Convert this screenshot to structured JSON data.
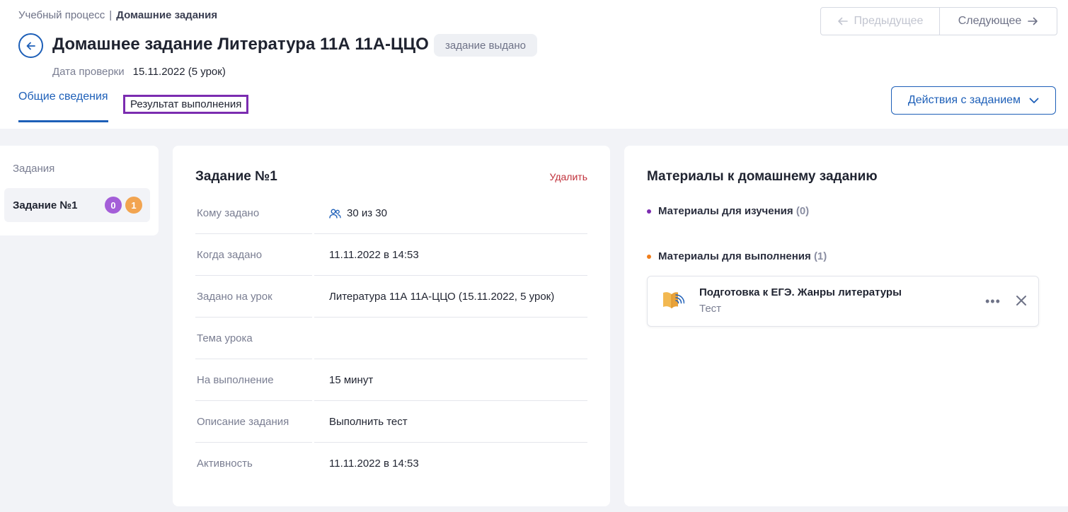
{
  "breadcrumb": {
    "parent": "Учебный процесс",
    "separator": "|",
    "current": "Домашние задания"
  },
  "header": {
    "title": "Домашнее задание Литература 11А 11А-ЦЦО",
    "status": "задание выдано",
    "date_label": "Дата проверки",
    "date_value": "15.11.2022 (5 урок)"
  },
  "nav": {
    "prev_label": "Предыдущее",
    "next_label": "Следующее"
  },
  "tabs": [
    {
      "label": "Общие сведения",
      "active": true
    },
    {
      "label": "Результат выполнения",
      "active": false
    }
  ],
  "actions_label": "Действия с заданием",
  "sidebar": {
    "header": "Задания",
    "items": [
      {
        "label": "Задание №1",
        "count_a": "0",
        "count_b": "1"
      }
    ]
  },
  "task": {
    "title": "Задание №1",
    "delete_label": "Удалить",
    "rows": [
      {
        "key": "Кому задано",
        "value": "30 из 30"
      },
      {
        "key": "Когда задано",
        "value": "11.11.2022 в 14:53"
      },
      {
        "key": "Задано на урок",
        "value": "Литература 11А 11А-ЦЦО (15.11.2022, 5 урок)"
      },
      {
        "key": "Тема урока",
        "value": ""
      },
      {
        "key": "На выполнение",
        "value": "15 минут"
      },
      {
        "key": "Описание задания",
        "value": "Выполнить тест"
      },
      {
        "key": "Активность",
        "value": "11.11.2022 в 14:53"
      }
    ]
  },
  "materials": {
    "title": "Материалы к домашнему заданию",
    "study_label": "Материалы для изучения",
    "study_count": "(0)",
    "exec_label": "Материалы для выполнения",
    "exec_count": "(1)",
    "item": {
      "title": "Подготовка к ЕГЭ. Жанры литературы",
      "type": "Тест"
    }
  },
  "colors": {
    "accent": "#1d5fb8",
    "purple": "#a45ed8",
    "orange": "#f2a450",
    "delete": "#c0303a",
    "tab_outline": "#7b2cb0"
  }
}
